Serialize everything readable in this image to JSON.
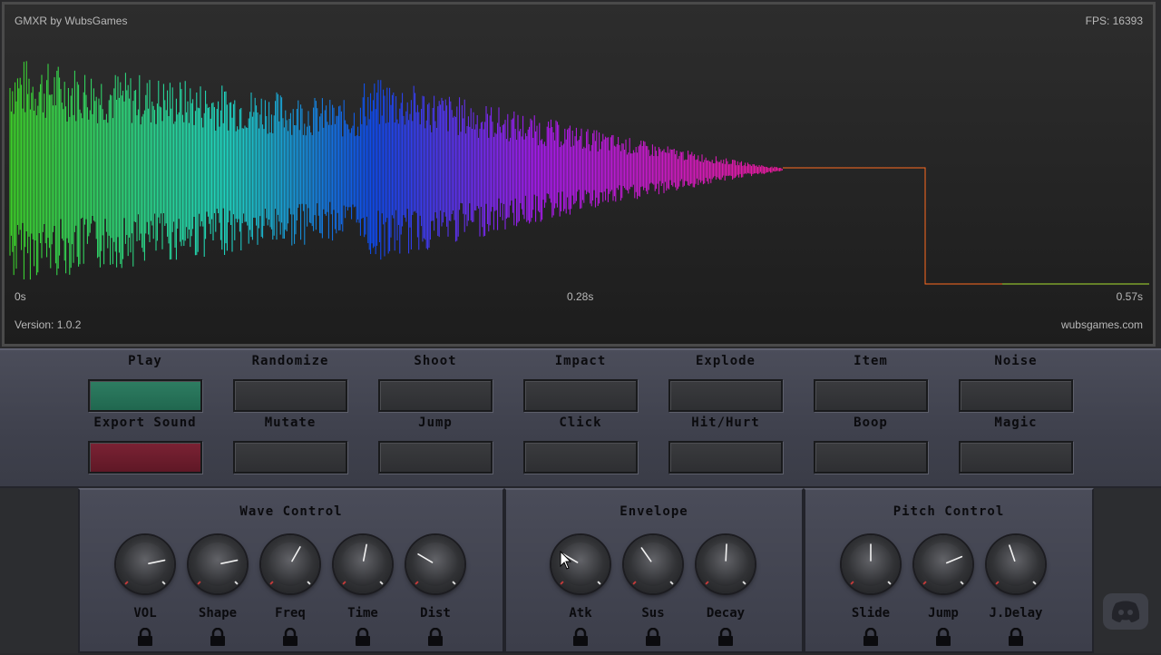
{
  "app": {
    "title": "GMXR by WubsGames",
    "fps": "FPS: 16393",
    "version": "Version: 1.0.2",
    "website": "wubsgames.com"
  },
  "timeline": {
    "start": "0s",
    "mid": "0.28s",
    "end": "0.57s"
  },
  "buttons": [
    {
      "name": "play",
      "label": "Play",
      "style": "play"
    },
    {
      "name": "randomize",
      "label": "Randomize"
    },
    {
      "name": "shoot",
      "label": "Shoot"
    },
    {
      "name": "impact",
      "label": "Impact"
    },
    {
      "name": "explode",
      "label": "Explode"
    },
    {
      "name": "item",
      "label": "Item"
    },
    {
      "name": "noise",
      "label": "Noise"
    },
    {
      "name": "export-sound",
      "label": "Export Sound",
      "style": "export"
    },
    {
      "name": "mutate",
      "label": "Mutate"
    },
    {
      "name": "jump",
      "label": "Jump"
    },
    {
      "name": "click",
      "label": "Click"
    },
    {
      "name": "hit-hurt",
      "label": "Hit/Hurt"
    },
    {
      "name": "boop",
      "label": "Boop"
    },
    {
      "name": "magic",
      "label": "Magic"
    }
  ],
  "sections": [
    {
      "name": "wave-control",
      "title": "Wave Control",
      "knobs": [
        {
          "name": "vol",
          "label": "VOL",
          "value": 0.79
        },
        {
          "name": "shape",
          "label": "Shape",
          "value": 0.79
        },
        {
          "name": "freq",
          "label": "Freq",
          "value": 0.61
        },
        {
          "name": "time",
          "label": "Time",
          "value": 0.54
        },
        {
          "name": "dist",
          "label": "Dist",
          "value": 0.28
        }
      ]
    },
    {
      "name": "envelope",
      "title": "Envelope",
      "knobs": [
        {
          "name": "atk",
          "label": "Atk",
          "value": 0.28
        },
        {
          "name": "sus",
          "label": "Sus",
          "value": 0.37
        },
        {
          "name": "decay",
          "label": "Decay",
          "value": 0.51
        }
      ]
    },
    {
      "name": "pitch-control",
      "title": "Pitch Control",
      "knobs": [
        {
          "name": "slide",
          "label": "Slide",
          "value": 0.5
        },
        {
          "name": "jump",
          "label": "Jump",
          "value": 0.75
        },
        {
          "name": "jdelay",
          "label": "J.Delay",
          "value": 0.43
        }
      ]
    }
  ],
  "colors": {
    "play": "#2e7d62",
    "export": "#7b2234",
    "wave_start": "#3fe12a",
    "wave_mid": "#0d4dff",
    "wave_end": "#ff1aa8",
    "tail_line": "#ff6a20"
  },
  "icons": {
    "lock": "lock-icon",
    "discord": "discord-icon"
  }
}
